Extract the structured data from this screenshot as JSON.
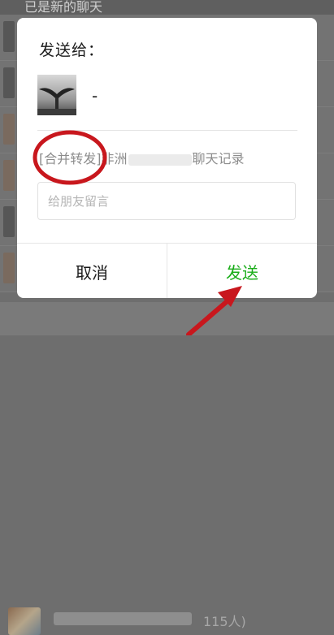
{
  "background": {
    "header_text": "已是新的聊天",
    "member_count": "115人)"
  },
  "dialog": {
    "title": "发送给：",
    "contact": {
      "name": "-"
    },
    "forward_text_prefix": "[合并转发]",
    "forward_text_mid": "非洲",
    "forward_text_suffix": "聊天记录",
    "message_placeholder": "给朋友留言",
    "cancel_label": "取消",
    "send_label": "发送"
  },
  "colors": {
    "send": "#1aad19",
    "annotation": "#c8171d",
    "overlay": "#6e6e6e"
  },
  "annotations": [
    "red-circle-around-merge-forward",
    "red-arrow-pointing-to-send"
  ]
}
